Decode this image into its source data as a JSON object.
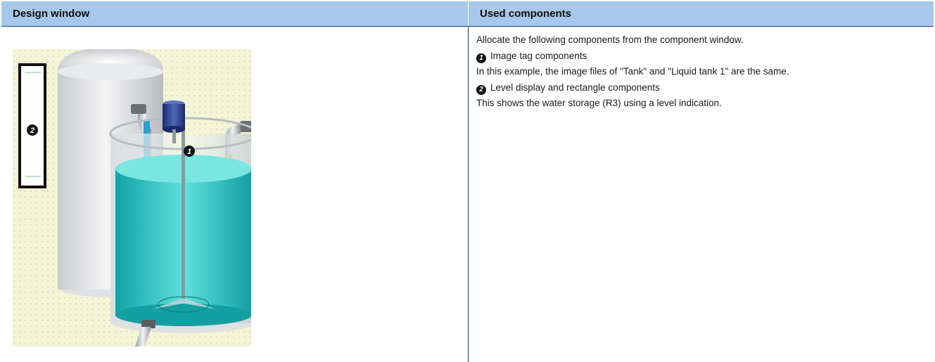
{
  "table": {
    "header_left": "Design window",
    "header_right": "Used components"
  },
  "design_window": {
    "marker_1": "1",
    "marker_2": "2",
    "icons": [
      "tank-image-icon",
      "liquid-tank-image-icon",
      "level-display-icon"
    ],
    "colors": {
      "grid_background": "#f4f5d6",
      "water": "#2fc4c4",
      "marker": "#111111"
    }
  },
  "components": {
    "intro": "Allocate the following components from the component window.",
    "items": [
      {
        "marker": "1",
        "title": "Image tag components",
        "description": "In this example, the image files of \"Tank\" and \"Liquid tank 1\" are the same."
      },
      {
        "marker": "2",
        "title": "Level display and rectangle components",
        "description": "This shows the water storage (R3) using a level indication."
      }
    ]
  },
  "colors": {
    "header_background": "#a6c8ea",
    "divider": "#1f3c88"
  }
}
